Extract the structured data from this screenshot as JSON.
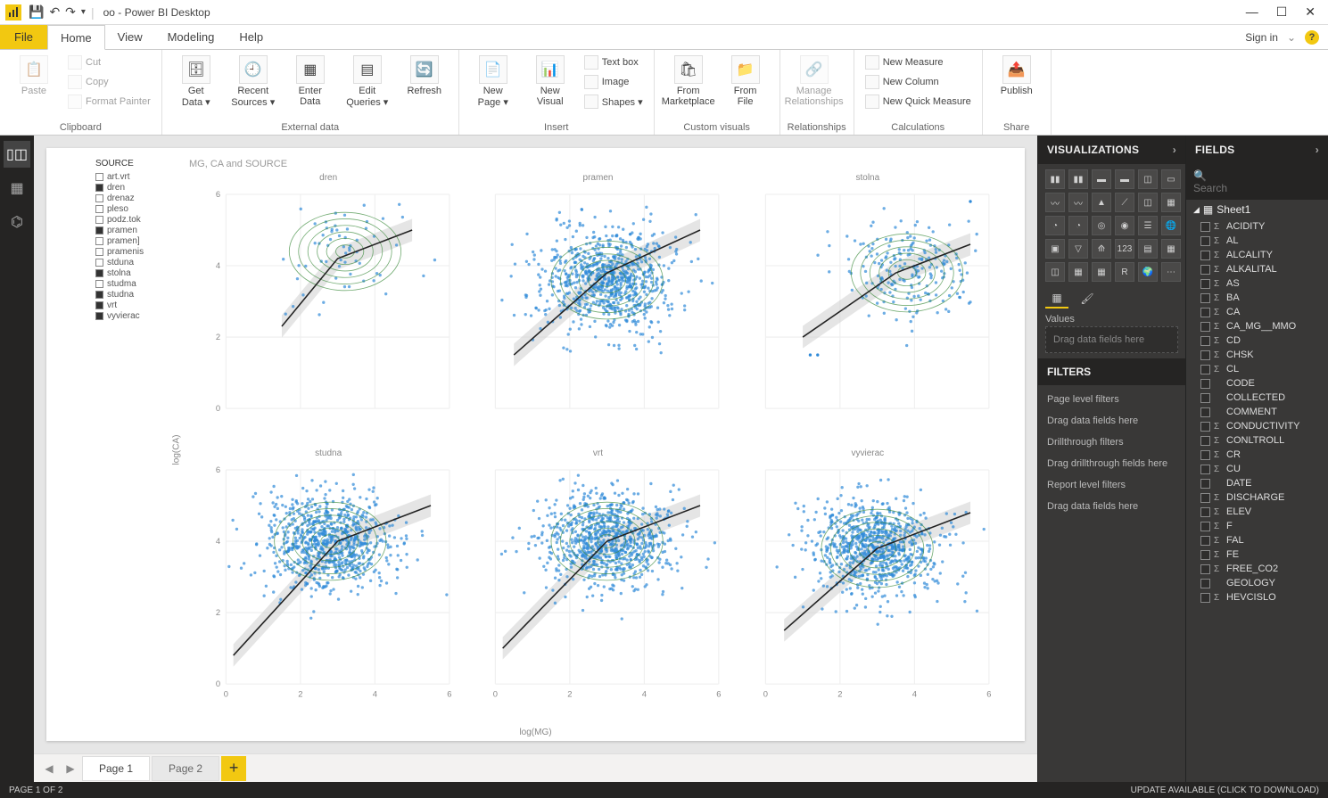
{
  "titlebar": {
    "doc_title": "oo - Power BI Desktop"
  },
  "window_controls": {
    "min": "—",
    "max": "☐",
    "close": "✕"
  },
  "ribbon_tabs": {
    "file": "File",
    "home": "Home",
    "view": "View",
    "modeling": "Modeling",
    "help": "Help",
    "signin": "Sign in"
  },
  "ribbon": {
    "clipboard": {
      "label": "Clipboard",
      "paste": "Paste",
      "cut": "Cut",
      "copy": "Copy",
      "format_painter": "Format Painter"
    },
    "external": {
      "label": "External data",
      "get_data": "Get\nData ▾",
      "recent": "Recent\nSources ▾",
      "enter": "Enter\nData",
      "edit": "Edit\nQueries ▾",
      "refresh": "Refresh"
    },
    "insert": {
      "label": "Insert",
      "new_page": "New\nPage ▾",
      "new_visual": "New\nVisual",
      "text_box": "Text box",
      "image": "Image",
      "shapes": "Shapes ▾"
    },
    "custom": {
      "label": "Custom visuals",
      "marketplace": "From\nMarketplace",
      "file": "From\nFile"
    },
    "relationships": {
      "label": "Relationships",
      "manage": "Manage\nRelationships"
    },
    "calc": {
      "label": "Calculations",
      "measure": "New Measure",
      "column": "New Column",
      "quick": "New Quick Measure"
    },
    "share": {
      "label": "Share",
      "publish": "Publish"
    }
  },
  "legend": {
    "header": "SOURCE",
    "items": [
      {
        "label": "art.vrt",
        "filled": false
      },
      {
        "label": "dren",
        "filled": true
      },
      {
        "label": "drenaz",
        "filled": false
      },
      {
        "label": "pleso",
        "filled": false
      },
      {
        "label": "podz.tok",
        "filled": false
      },
      {
        "label": "pramen",
        "filled": true
      },
      {
        "label": "pramen]",
        "filled": false
      },
      {
        "label": "pramenis",
        "filled": false
      },
      {
        "label": "stduna",
        "filled": false
      },
      {
        "label": "stolna",
        "filled": true
      },
      {
        "label": "studma",
        "filled": false
      },
      {
        "label": "studna",
        "filled": true
      },
      {
        "label": "vrt",
        "filled": true
      },
      {
        "label": "vyvierac",
        "filled": true
      }
    ]
  },
  "chart": {
    "title": "MG, CA and SOURCE",
    "xlabel": "log(MG)",
    "ylabel": "log(CA)",
    "panels": [
      "dren",
      "pramen",
      "stolna",
      "studna",
      "vrt",
      "vyvierac"
    ]
  },
  "chart_data": {
    "type": "scatter",
    "facet_by": "SOURCE",
    "xlabel": "log(MG)",
    "ylabel": "log(CA)",
    "xlim": [
      0,
      6
    ],
    "ylim": [
      0,
      6
    ],
    "xticks": [
      0,
      2,
      4,
      6
    ],
    "yticks": [
      0,
      2,
      4,
      6
    ],
    "note": "point positions estimated from pixels; dense clusters summarized",
    "panels": [
      {
        "name": "dren",
        "trend": [
          [
            1.5,
            2.3
          ],
          [
            3.0,
            4.2
          ],
          [
            5.0,
            5.0
          ]
        ],
        "cluster_center": [
          3.2,
          4.4
        ],
        "n_approx": 60
      },
      {
        "name": "pramen",
        "trend": [
          [
            0.5,
            1.5
          ],
          [
            3.0,
            3.8
          ],
          [
            5.5,
            5.0
          ]
        ],
        "cluster_center": [
          3.0,
          3.6
        ],
        "n_approx": 3000
      },
      {
        "name": "stolna",
        "trend": [
          [
            1.0,
            2.0
          ],
          [
            3.5,
            3.8
          ],
          [
            5.5,
            4.6
          ]
        ],
        "cluster_center": [
          3.8,
          3.8
        ],
        "n_approx": 200,
        "outliers": [
          [
            5.5,
            5.8
          ],
          [
            1.2,
            1.5
          ],
          [
            1.4,
            1.5
          ]
        ]
      },
      {
        "name": "studna",
        "trend": [
          [
            0.2,
            0.8
          ],
          [
            3.0,
            4.0
          ],
          [
            5.5,
            5.0
          ]
        ],
        "cluster_center": [
          2.8,
          4.0
        ],
        "n_approx": 2500
      },
      {
        "name": "vrt",
        "trend": [
          [
            0.2,
            1.0
          ],
          [
            3.0,
            4.0
          ],
          [
            5.5,
            5.0
          ]
        ],
        "cluster_center": [
          3.0,
          4.0
        ],
        "n_approx": 2500
      },
      {
        "name": "vyvierac",
        "trend": [
          [
            0.5,
            1.5
          ],
          [
            3.0,
            3.8
          ],
          [
            5.5,
            4.8
          ]
        ],
        "cluster_center": [
          3.0,
          3.8
        ],
        "n_approx": 1200
      }
    ]
  },
  "pages": {
    "page1": "Page 1",
    "page2": "Page 2",
    "status": "PAGE 1 OF 2"
  },
  "viz_pane": {
    "header": "VISUALIZATIONS",
    "values_label": "Values",
    "values_placeholder": "Drag data fields here",
    "filters_header": "FILTERS",
    "page_filters": "Page level filters",
    "page_filters_drop": "Drag data fields here",
    "drill_filters": "Drillthrough filters",
    "drill_filters_drop": "Drag drillthrough fields here",
    "report_filters": "Report level filters",
    "report_filters_drop": "Drag data fields here"
  },
  "fields_pane": {
    "header": "FIELDS",
    "search_placeholder": "Search",
    "table": "Sheet1",
    "fields": [
      {
        "name": "ACIDITY",
        "sum": true
      },
      {
        "name": "AL",
        "sum": true
      },
      {
        "name": "ALCALITY",
        "sum": true
      },
      {
        "name": "ALKALITAL",
        "sum": true
      },
      {
        "name": "AS",
        "sum": true
      },
      {
        "name": "BA",
        "sum": true
      },
      {
        "name": "CA",
        "sum": true
      },
      {
        "name": "CA_MG__MMO",
        "sum": true
      },
      {
        "name": "CD",
        "sum": true
      },
      {
        "name": "CHSK",
        "sum": true
      },
      {
        "name": "CL",
        "sum": true
      },
      {
        "name": "CODE",
        "sum": false
      },
      {
        "name": "COLLECTED",
        "sum": false
      },
      {
        "name": "COMMENT",
        "sum": false
      },
      {
        "name": "CONDUCTIVITY",
        "sum": true
      },
      {
        "name": "CONLTROLL",
        "sum": true
      },
      {
        "name": "CR",
        "sum": true
      },
      {
        "name": "CU",
        "sum": true
      },
      {
        "name": "DATE",
        "sum": false
      },
      {
        "name": "DISCHARGE",
        "sum": true
      },
      {
        "name": "ELEV",
        "sum": true
      },
      {
        "name": "F",
        "sum": true
      },
      {
        "name": "FAL",
        "sum": true
      },
      {
        "name": "FE",
        "sum": true
      },
      {
        "name": "FREE_CO2",
        "sum": true
      },
      {
        "name": "GEOLOGY",
        "sum": false
      },
      {
        "name": "HEVCISLO",
        "sum": true
      }
    ]
  },
  "statusbar": {
    "update": "UPDATE AVAILABLE (CLICK TO DOWNLOAD)"
  }
}
